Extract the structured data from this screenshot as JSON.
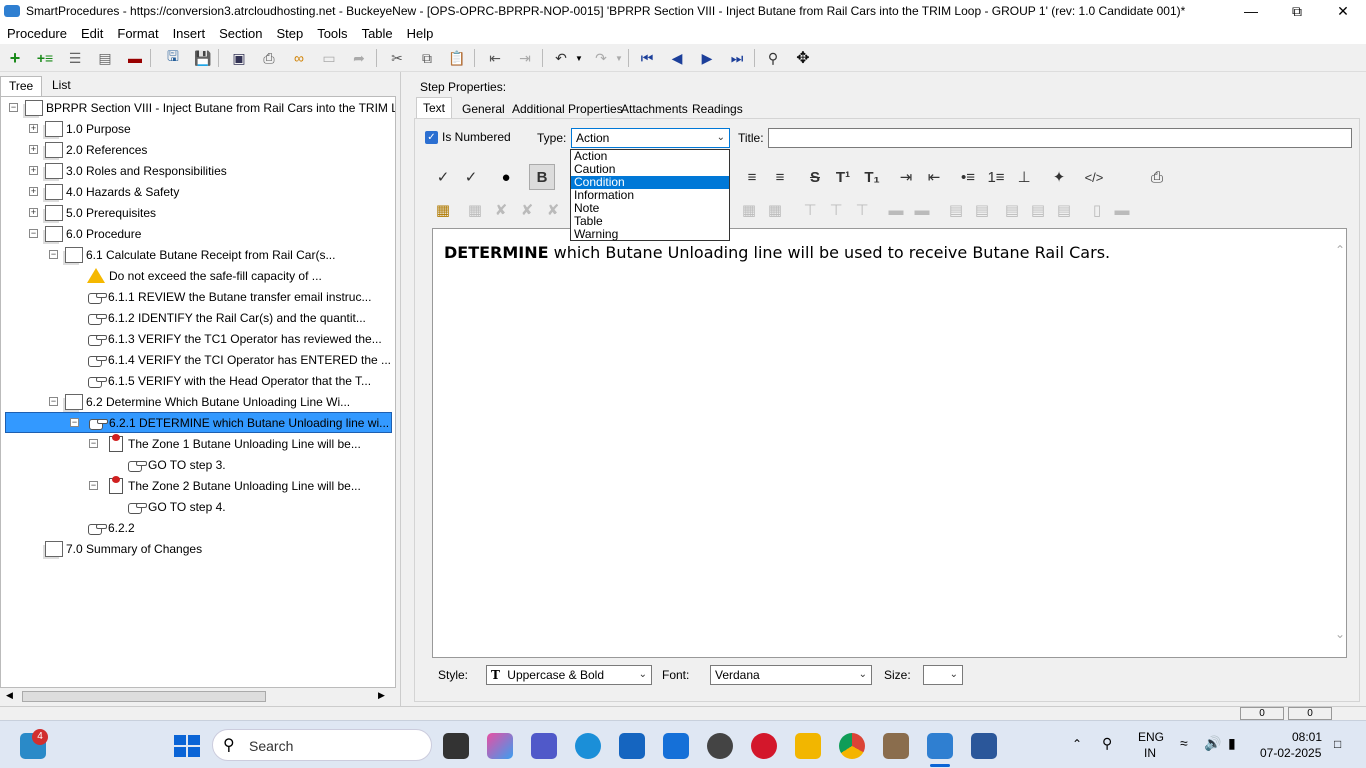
{
  "window": {
    "title": "SmartProcedures - https://conversion3.atrcloudhosting.net - BuckeyeNew - [OPS-OPRC-BPRPR-NOP-0015] 'BPRPR Section VIII - Inject Butane from Rail Cars into the TRIM Loop - GROUP 1' (rev: 1.0 Candidate 001)*",
    "minimize": "—",
    "maximize": "⧉",
    "close": "✕"
  },
  "menu": [
    "Procedure",
    "Edit",
    "Format",
    "Insert",
    "Section",
    "Step",
    "Tools",
    "Table",
    "Help"
  ],
  "left_tabs": {
    "tree": "Tree",
    "list": "List"
  },
  "tree": [
    {
      "label": "BPRPR Section VIII - Inject Butane from Rail Cars into the TRIM L..."
    },
    {
      "label": "1.0 Purpose"
    },
    {
      "label": "2.0 References"
    },
    {
      "label": "3.0 Roles and Responsibilities"
    },
    {
      "label": "4.0 Hazards & Safety"
    },
    {
      "label": "5.0 Prerequisites"
    },
    {
      "label": "6.0 Procedure"
    },
    {
      "label": "6.1 Calculate Butane Receipt from Rail Car(s..."
    },
    {
      "label": "Do not exceed the safe-fill capacity of ..."
    },
    {
      "label": "6.1.1 REVIEW the Butane transfer email instruc..."
    },
    {
      "label": "6.1.2 IDENTIFY the Rail Car(s) and the quantit..."
    },
    {
      "label": "6.1.3 VERIFY the TC1 Operator has reviewed the..."
    },
    {
      "label": "6.1.4 VERIFY the TCI Operator has ENTERED the ..."
    },
    {
      "label": "6.1.5 VERIFY with the Head Operator that the T..."
    },
    {
      "label": "6.2 Determine Which Butane Unloading Line Wi..."
    },
    {
      "label": "6.2.1 DETERMINE which Butane Unloading line wi..."
    },
    {
      "label": "The Zone 1 Butane Unloading Line will be..."
    },
    {
      "label": "GO TO step 3."
    },
    {
      "label": "The Zone 2 Butane Unloading Line will be..."
    },
    {
      "label": "GO TO step 4."
    },
    {
      "label": "6.2.2"
    },
    {
      "label": "7.0 Summary of Changes"
    }
  ],
  "step_properties": {
    "heading": "Step Properties:",
    "tabs": [
      "Text",
      "General",
      "Additional Properties",
      "Attachments",
      "Readings"
    ],
    "is_numbered_label": "Is Numbered",
    "type_label": "Type:",
    "type_value": "Action",
    "title_label": "Title:",
    "title_value": "",
    "type_options": [
      "Action",
      "Caution",
      "Condition",
      "Information",
      "Note",
      "Table",
      "Warning"
    ],
    "highlighted_option": "Condition"
  },
  "editor": {
    "bold_word": "DETERMINE",
    "rest_text": " which Butane Unloading line will be used to receive Butane Rail Cars."
  },
  "bottom": {
    "style_label": "Style:",
    "style_value": "Uppercase & Bold",
    "font_label": "Font:",
    "font_value": "Verdana",
    "size_label": "Size:",
    "size_value": "",
    "status_1": "0",
    "status_2": "0"
  },
  "taskbar": {
    "notif_count": "4",
    "search": "Search",
    "lang_1": "ENG",
    "lang_2": "IN",
    "time": "08:01",
    "date": "07-02-2025"
  },
  "colors": {
    "selection": "#3399ff",
    "dropdown_highlight": "#0078d7",
    "accent": "#2f7fd1"
  }
}
